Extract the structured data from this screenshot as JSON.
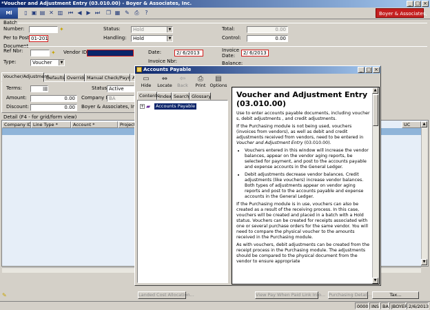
{
  "window": {
    "title": "*Voucher and Adjustment Entry (03.010.00) - Boyer & Associates, Inc."
  },
  "toolbar": {
    "app_button": "Ml",
    "company": "Boyer & Associates,"
  },
  "batch": {
    "group_label": "Batch",
    "number_label": "Number:",
    "per_to_post_label": "Per to Post:",
    "per_to_post_value": "01-2013",
    "status_label": "Status:",
    "status_value": "Hold",
    "handling_label": "Handling:",
    "handling_value": "Hold",
    "total_label": "Total:",
    "total_value": "0.00",
    "control_label": "Control:",
    "control_value": "0.00"
  },
  "document": {
    "group_label": "Document",
    "ref_nbr_label": "Ref Nbr:",
    "type_label": "Type:",
    "type_value": "Voucher",
    "vendor_id_label": "Vendor ID:",
    "date_label": "Date:",
    "date_value": "2/ 6/2013",
    "invoice_date_label": "Invoice Date:",
    "invoice_date_value": "2/ 6/2013",
    "invoice_nbr_label": "Invoice Nbr:",
    "balance_label": "Balance:"
  },
  "tabs": [
    "Voucher/Adjustment",
    "Defaults",
    "Override",
    "Manual Check/Payment",
    "A"
  ],
  "voucher_tab": {
    "terms_label": "Terms:",
    "amount_label": "Amount:",
    "amount_value": "0.00",
    "discount_label": "Discount:",
    "discount_value": "0.00",
    "status_label": "Status:",
    "status_value": "Active",
    "company_id_label": "Company ID:",
    "company_id_value": "BA",
    "company_name": "Boyer & Associates, Inc."
  },
  "detail": {
    "label": "Detail  (F4 - for grid/form view)",
    "columns": [
      "Company ID *",
      "Line Type *",
      "Account *",
      "Project"
    ],
    "right_column": "UC"
  },
  "bottom_buttons": {
    "landed_cost": "Landed Cost Allocation...",
    "view_pay": "View Pay When Paid Link Info...",
    "purchasing_detail": "Purchasing Detail...",
    "tax": "Tax..."
  },
  "status_bar": {
    "code": "0000",
    "ins": "INS",
    "company": "BA",
    "user": "JBOYER",
    "date": "2/6/2013"
  },
  "help": {
    "title": "Accounts Payable",
    "toolbar": {
      "hide": "Hide",
      "locate": "Locate",
      "back": "Back",
      "print": "Print",
      "options": "Options"
    },
    "tabs": [
      "Contents",
      "Index",
      "Search",
      "Glossary"
    ],
    "tree_item": "Accounts Payable",
    "heading": "Voucher and Adjustment Entry (03.010.00)",
    "para1": "Use to enter accounts payable documents, including voucher s, debit adjustments , and credit adjustments.",
    "para2_start": "If the Purchasing module is not being used, vouchers (invoices from vendors), as well as debit and credit adjustments received from vendors, need to be entered in ",
    "para2_link": "Voucher and Adjustment Entry",
    "para2_end": " (03.010.00).",
    "bullet1": "Vouchers entered in this window will increase the vendor balances, appear on the vendor aging reports, be selected for payment, and post to the accounts payable and expense accounts in the General Ledger.",
    "bullet2": "Debit adjustments decrease vendor balances. Credit adjustments (like vouchers) increase vendor balances. Both types of adjustments appear on vendor aging reports and post to the accounts payable and expense accounts in the General Ledger.",
    "para3": "If the Purchasing module is in use, vouchers can also be created as a result of the receiving process. In this case, vouchers will be created and placed in a batch with a Hold status. Vouchers can be created for receipts associated with one or several purchase orders for the same vendor. You will need to compare the physical voucher to the amounts received in the Purchasing module.",
    "para4": "As with vouchers, debit adjustments can be created from the receipt process in the Purchasing module. The adjustments should be compared to the physical document from the vendor to ensure appropriate"
  }
}
